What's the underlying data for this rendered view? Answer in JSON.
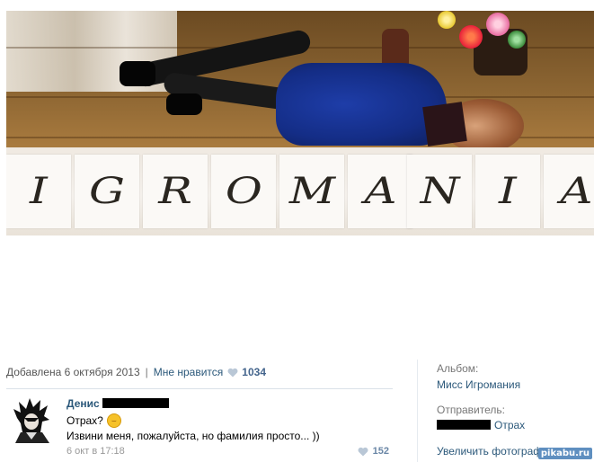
{
  "photo": {
    "letters": [
      "I",
      "G",
      "R",
      "O",
      "M",
      "A",
      "N",
      "I",
      "A"
    ]
  },
  "meta": {
    "added_label": "Добавлена 6 октября 2013",
    "separator": "|",
    "like_label": "Мне нравится",
    "like_count": "1034"
  },
  "comment": {
    "author": "Денис",
    "line1": "Отрах?",
    "line2": "Извини меня, пожалуйста, но фамилия просто... ))",
    "time": "6 окт в 17:18",
    "likes": "152"
  },
  "sidebar": {
    "album_label": "Альбом:",
    "album_name": "Мисс Игромания",
    "sender_label": "Отправитель:",
    "sender_name": "Отрах",
    "enlarge_label": "Увеличить фотографию"
  },
  "watermark": "pikabu.ru",
  "colors": {
    "link": "#2b587a",
    "muted": "#777777",
    "like_heart": "#b9c7d6"
  }
}
